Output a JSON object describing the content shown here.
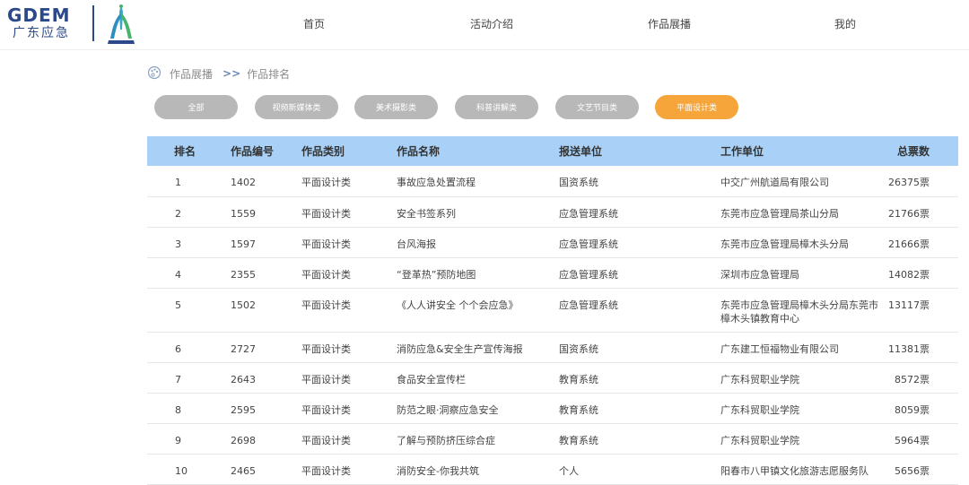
{
  "logo": {
    "brand": "GDEM",
    "brand_cn": "广东应急"
  },
  "nav": [
    {
      "label": "首页"
    },
    {
      "label": "活动介绍"
    },
    {
      "label": "作品展播"
    },
    {
      "label": "我的"
    }
  ],
  "breadcrumb": {
    "parent": "作品展播",
    "separator": ">>",
    "current": "作品排名"
  },
  "filters": [
    {
      "label": "全部",
      "active": false
    },
    {
      "label": "视频新媒体类",
      "active": false
    },
    {
      "label": "美术摄影类",
      "active": false
    },
    {
      "label": "科普讲解类",
      "active": false
    },
    {
      "label": "文艺节目类",
      "active": false
    },
    {
      "label": "平面设计类",
      "active": true
    }
  ],
  "colors": {
    "header_bg": "#a9d1f7",
    "active_pill": "#f5a53a",
    "inactive_pill": "#b8b8b8",
    "brand": "#2c4a8a"
  },
  "table": {
    "headers": [
      "排名",
      "作品编号",
      "作品类别",
      "作品名称",
      "报送单位",
      "工作单位",
      "总票数"
    ],
    "rows": [
      [
        "1",
        "1402",
        "平面设计类",
        "事故应急处置流程",
        "国资系统",
        "中交广州航道局有限公司",
        "26375票"
      ],
      [
        "2",
        "1559",
        "平面设计类",
        "安全书签系列",
        "应急管理系统",
        "东莞市应急管理局茶山分局",
        "21766票"
      ],
      [
        "3",
        "1597",
        "平面设计类",
        "台风海报",
        "应急管理系统",
        "东莞市应急管理局樟木头分局",
        "21666票"
      ],
      [
        "4",
        "2355",
        "平面设计类",
        "“登革热”预防地图",
        "应急管理系统",
        "深圳市应急管理局",
        "14082票"
      ],
      [
        "5",
        "1502",
        "平面设计类",
        "《人人讲安全 个个会应急》",
        "应急管理系统",
        "东莞市应急管理局樟木头分局东莞市樟木头镇教育中心",
        "13117票"
      ],
      [
        "6",
        "2727",
        "平面设计类",
        "消防应急&安全生产宣传海报",
        "国资系统",
        "广东建工恒福物业有限公司",
        "11381票"
      ],
      [
        "7",
        "2643",
        "平面设计类",
        "食品安全宣传栏",
        "教育系统",
        "广东科贸职业学院",
        "8572票"
      ],
      [
        "8",
        "2595",
        "平面设计类",
        "防范之眼·洞察应急安全",
        "教育系统",
        "广东科贸职业学院",
        "8059票"
      ],
      [
        "9",
        "2698",
        "平面设计类",
        "了解与预防挤压综合症",
        "教育系统",
        "广东科贸职业学院",
        "5964票"
      ],
      [
        "10",
        "2465",
        "平面设计类",
        "消防安全-你我共筑",
        "个人",
        "阳春市八甲镇文化旅游志愿服务队",
        "5656票"
      ]
    ]
  }
}
